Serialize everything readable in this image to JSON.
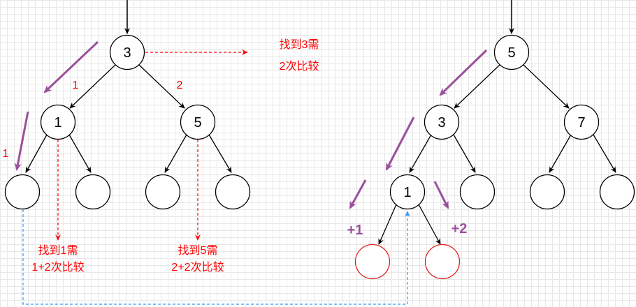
{
  "left_tree": {
    "root": "3",
    "left": "1",
    "right": "5",
    "edge_left_label": "1",
    "edge_right_label": "2",
    "edge_leaf_label": "1",
    "note_root_line1": "找到3需",
    "note_root_line2": "2次比较",
    "note_one_line1": "找到1需",
    "note_one_line2": "1+2次比较",
    "note_five_line1": "找到5需",
    "note_five_line2": "2+2次比较"
  },
  "right_tree": {
    "root": "5",
    "left": "3",
    "right": "7",
    "left_left": "1",
    "plus_one": "+1",
    "plus_two": "+2"
  },
  "colors": {
    "node_stroke": "#000000",
    "red": "#ff0000",
    "purple": "#9b4f9b",
    "blue": "#3399ff",
    "new_node": "#e02020"
  }
}
